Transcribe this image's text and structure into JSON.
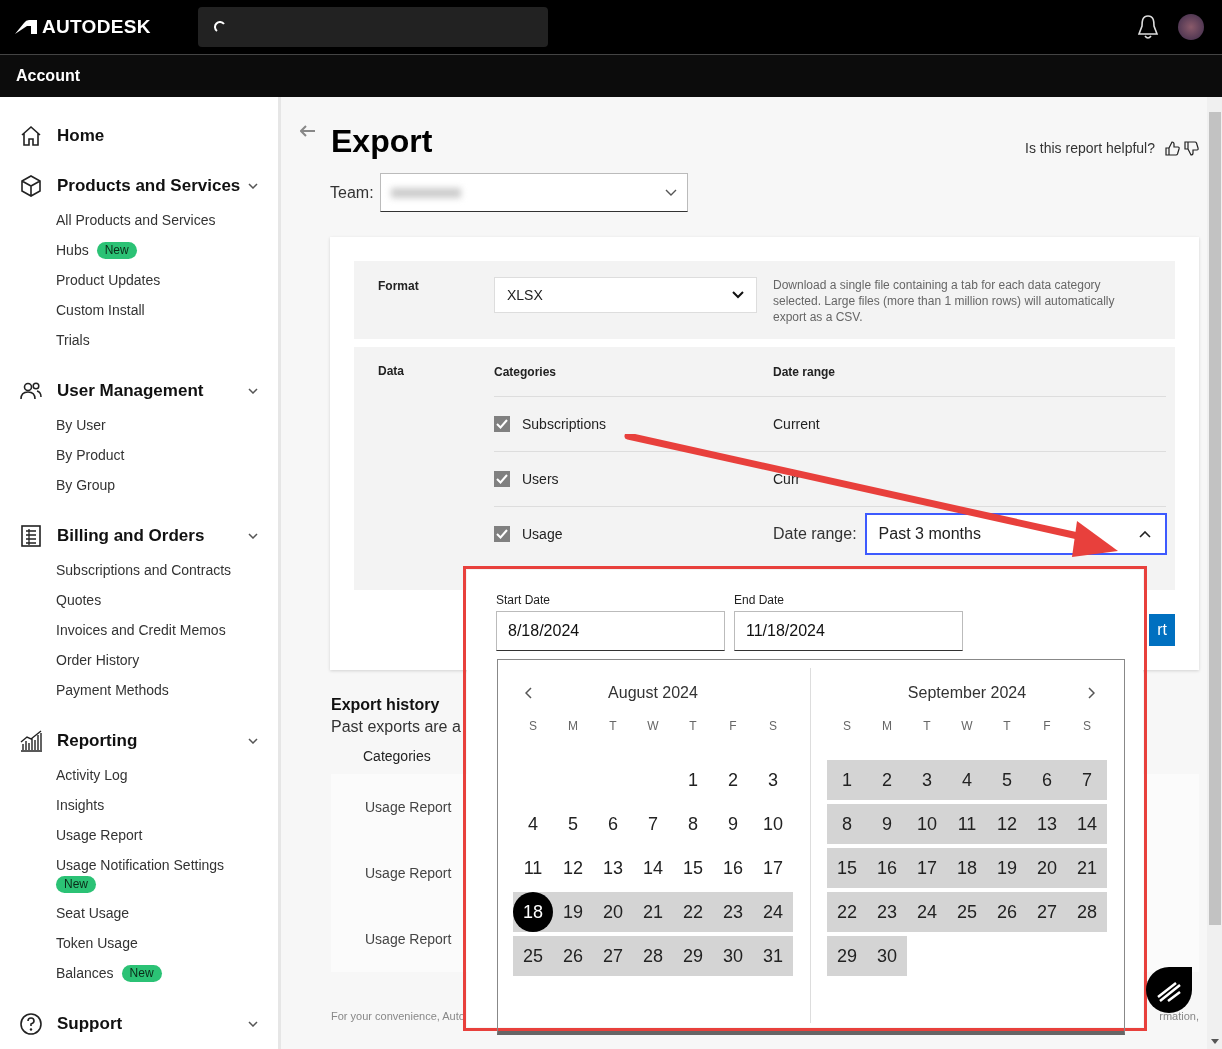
{
  "header": {
    "logo": "AUTODESK"
  },
  "account_bar": {
    "title": "Account"
  },
  "sidebar": {
    "sections": [
      {
        "title": "Home",
        "expandable": false
      },
      {
        "title": "Products and Services",
        "expandable": true,
        "items": [
          {
            "label": "All Products and Services"
          },
          {
            "label": "Hubs",
            "badge": "New"
          },
          {
            "label": "Product Updates"
          },
          {
            "label": "Custom Install"
          },
          {
            "label": "Trials"
          }
        ]
      },
      {
        "title": "User Management",
        "expandable": true,
        "items": [
          {
            "label": "By User"
          },
          {
            "label": "By Product"
          },
          {
            "label": "By Group"
          }
        ]
      },
      {
        "title": "Billing and Orders",
        "expandable": true,
        "items": [
          {
            "label": "Subscriptions and Contracts"
          },
          {
            "label": "Quotes"
          },
          {
            "label": "Invoices and Credit Memos"
          },
          {
            "label": "Order History"
          },
          {
            "label": "Payment Methods"
          }
        ]
      },
      {
        "title": "Reporting",
        "expandable": true,
        "items": [
          {
            "label": "Activity Log"
          },
          {
            "label": "Insights"
          },
          {
            "label": "Usage Report"
          },
          {
            "label": "Usage Notification Settings",
            "badge": "New"
          },
          {
            "label": "Seat Usage"
          },
          {
            "label": "Token Usage"
          },
          {
            "label": "Balances",
            "badge": "New"
          }
        ]
      },
      {
        "title": "Support",
        "expandable": true
      }
    ]
  },
  "page": {
    "title": "Export",
    "feedback": "Is this report helpful?",
    "team": {
      "label": "Team:"
    }
  },
  "export_form": {
    "format": {
      "label": "Format",
      "value": "XLSX",
      "description": "Download a single file containing a tab for each data category selected. Large files (more than 1 million rows) will automatically export as a CSV."
    },
    "data": {
      "label": "Data",
      "columns": [
        "Categories",
        "Date range"
      ],
      "rows": [
        {
          "kind": "text",
          "category": "Subscriptions",
          "checked": true,
          "date_range": "Current"
        },
        {
          "kind": "text",
          "category": "Users",
          "checked": true,
          "date_range": "Curr"
        },
        {
          "kind": "dropdown",
          "category": "Usage",
          "checked": true,
          "date_range_label": "Date range:",
          "date_range": "Past 3 months",
          "open": true
        }
      ]
    },
    "button": "rt"
  },
  "date_picker": {
    "start_label": "Start Date",
    "start_value": "8/18/2024",
    "end_label": "End Date",
    "end_value": "11/18/2024",
    "months": [
      {
        "title": "August 2024",
        "weekdays": [
          "S",
          "M",
          "T",
          "W",
          "T",
          "F",
          "S"
        ],
        "weeks": [
          [
            {
              "label": "1",
              "in_range": false,
              "selected": false
            },
            {
              "label": "2",
              "in_range": false,
              "selected": false
            },
            {
              "label": "3",
              "in_range": false,
              "selected": false
            }
          ],
          [
            {
              "label": "4",
              "in_range": false,
              "selected": false
            },
            {
              "label": "5",
              "in_range": false,
              "selected": false
            },
            {
              "label": "6",
              "in_range": false,
              "selected": false
            },
            {
              "label": "7",
              "in_range": false,
              "selected": false
            },
            {
              "label": "8",
              "in_range": false,
              "selected": false
            },
            {
              "label": "9",
              "in_range": false,
              "selected": false
            },
            {
              "label": "10",
              "in_range": false,
              "selected": false
            }
          ],
          [
            {
              "label": "11",
              "in_range": false,
              "selected": false
            },
            {
              "label": "12",
              "in_range": false,
              "selected": false
            },
            {
              "label": "13",
              "in_range": false,
              "selected": false
            },
            {
              "label": "14",
              "in_range": false,
              "selected": false
            },
            {
              "label": "15",
              "in_range": false,
              "selected": false
            },
            {
              "label": "16",
              "in_range": false,
              "selected": false
            },
            {
              "label": "17",
              "in_range": false,
              "selected": false
            }
          ],
          [
            {
              "label": "18",
              "in_range": true,
              "selected": true
            },
            {
              "label": "19",
              "in_range": true,
              "selected": false
            },
            {
              "label": "20",
              "in_range": true,
              "selected": false
            },
            {
              "label": "21",
              "in_range": true,
              "selected": false
            },
            {
              "label": "22",
              "in_range": true,
              "selected": false
            },
            {
              "label": "23",
              "in_range": true,
              "selected": false
            },
            {
              "label": "24",
              "in_range": true,
              "selected": false
            }
          ],
          [
            {
              "label": "25",
              "in_range": true,
              "selected": false
            },
            {
              "label": "26",
              "in_range": true,
              "selected": false
            },
            {
              "label": "27",
              "in_range": true,
              "selected": false
            },
            {
              "label": "28",
              "in_range": true,
              "selected": false
            },
            {
              "label": "29",
              "in_range": true,
              "selected": false
            },
            {
              "label": "30",
              "in_range": true,
              "selected": false
            },
            {
              "label": "31",
              "in_range": true,
              "selected": false
            }
          ]
        ]
      },
      {
        "title": "September 2024",
        "weekdays": [
          "S",
          "M",
          "T",
          "W",
          "T",
          "F",
          "S"
        ],
        "weeks": [
          [
            {
              "label": "1",
              "in_range": true,
              "selected": false
            },
            {
              "label": "2",
              "in_range": true,
              "selected": false
            },
            {
              "label": "3",
              "in_range": true,
              "selected": false
            },
            {
              "label": "4",
              "in_range": true,
              "selected": false
            },
            {
              "label": "5",
              "in_range": true,
              "selected": false
            },
            {
              "label": "6",
              "in_range": true,
              "selected": false
            },
            {
              "label": "7",
              "in_range": true,
              "selected": false
            }
          ],
          [
            {
              "label": "8",
              "in_range": true,
              "selected": false
            },
            {
              "label": "9",
              "in_range": true,
              "selected": false
            },
            {
              "label": "10",
              "in_range": true,
              "selected": false
            },
            {
              "label": "11",
              "in_range": true,
              "selected": false
            },
            {
              "label": "12",
              "in_range": true,
              "selected": false
            },
            {
              "label": "13",
              "in_range": true,
              "selected": false
            },
            {
              "label": "14",
              "in_range": true,
              "selected": false
            }
          ],
          [
            {
              "label": "15",
              "in_range": true,
              "selected": false
            },
            {
              "label": "16",
              "in_range": true,
              "selected": false
            },
            {
              "label": "17",
              "in_range": true,
              "selected": false
            },
            {
              "label": "18",
              "in_range": true,
              "selected": false
            },
            {
              "label": "19",
              "in_range": true,
              "selected": false
            },
            {
              "label": "20",
              "in_range": true,
              "selected": false
            },
            {
              "label": "21",
              "in_range": true,
              "selected": false
            }
          ],
          [
            {
              "label": "22",
              "in_range": true,
              "selected": false
            },
            {
              "label": "23",
              "in_range": true,
              "selected": false
            },
            {
              "label": "24",
              "in_range": true,
              "selected": false
            },
            {
              "label": "25",
              "in_range": true,
              "selected": false
            },
            {
              "label": "26",
              "in_range": true,
              "selected": false
            },
            {
              "label": "27",
              "in_range": true,
              "selected": false
            },
            {
              "label": "28",
              "in_range": true,
              "selected": false
            }
          ],
          [
            {
              "label": "29",
              "in_range": true,
              "selected": false
            },
            {
              "label": "30",
              "in_range": true,
              "selected": false
            }
          ]
        ]
      }
    ]
  },
  "export_history": {
    "title": "Export history",
    "subtitle": "Past exports are a",
    "columns": [
      "Categories"
    ],
    "rows": [
      {
        "category": "Usage Report"
      },
      {
        "category": "Usage Report"
      },
      {
        "category": "Usage Report"
      }
    ],
    "footer": {
      "left": "For your convenience, Auto",
      "right": "rmation,"
    }
  }
}
